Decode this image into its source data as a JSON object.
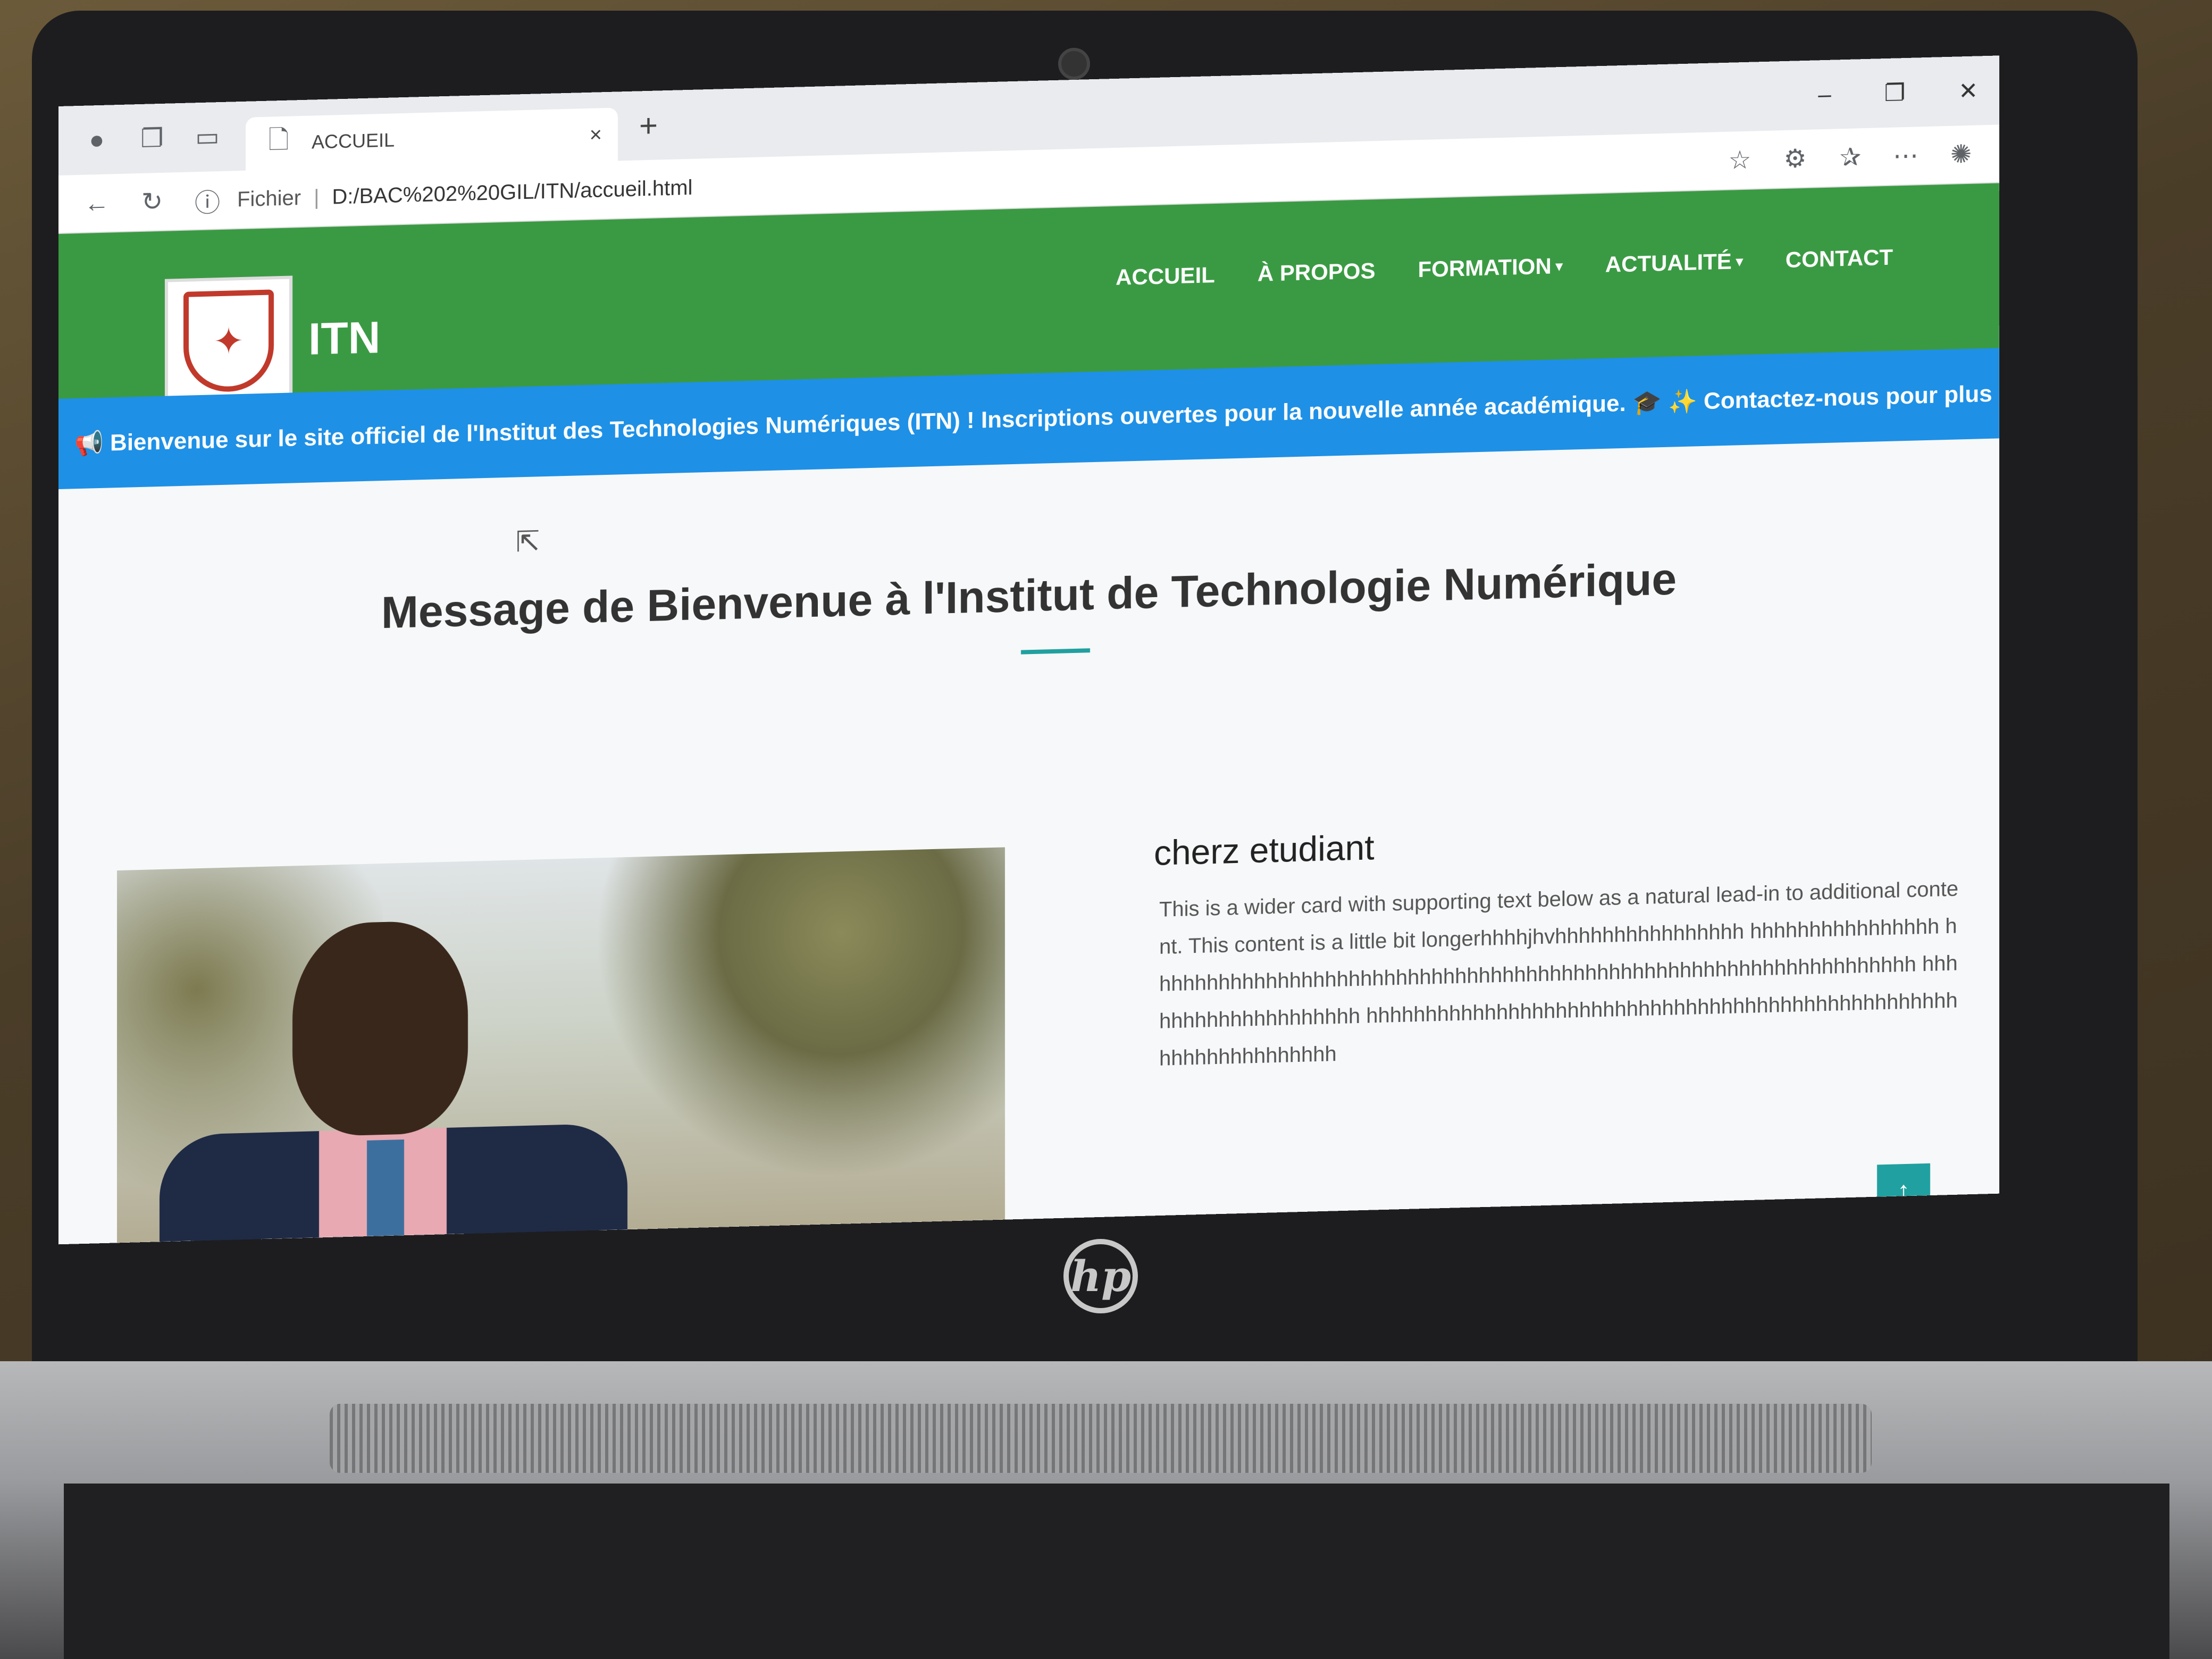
{
  "browser": {
    "tab_title": "ACCUEIL",
    "address_label": "Fichier",
    "address_url": "D:/BAC%202%20GIL/ITN/accueil.html"
  },
  "site": {
    "brand": "ITN",
    "nav": [
      "ACCUEIL",
      "À PROPOS",
      "FORMATION",
      "ACTUALITÉ",
      "CONTACT"
    ],
    "ticker": "📢 Bienvenue sur le site officiel de l'Institut des Technologies Numériques (ITN) ! Inscriptions ouvertes pour la nouvelle année académique. 🎓 ✨ Contactez-nous pour plus d'info",
    "heading": "Message de Bienvenue à l'Institut de Technologie Numérique",
    "card_title": "cherz etudiant",
    "card_text": "This is a wider card with supporting text below as a natural lead-in to additional content. This content is a little bit longerhhhhjhvhhhhhhhhhhhhhhhh hhhhhhhhhhhhhhhh hhhhhhhhhhhhhhhhhhhhhhhhhhhhhhhhhhhhhhhhhhhhhhhhhhhhhhhhhhhhhhhhh hhhhhhhhhhhhhhhhhhhh hhhhhhhhhhhhhhhhhhhhhhhhhhhhhhhhhhhhhhhhhhhhhhhhhhhhhhhhhhhhhhhhh",
    "back_to_top": "↑"
  },
  "laptop": {
    "logo": "hp"
  },
  "colors": {
    "navbar": "#3a9a43",
    "ticker": "#1e90e6",
    "accent": "#20a0a0"
  }
}
